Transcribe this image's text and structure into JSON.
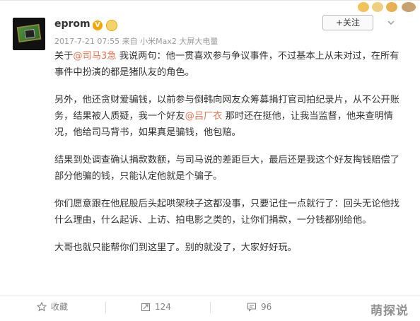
{
  "post": {
    "username": "eprom",
    "meta": "2017-7-21 07:55 来自 小米Max2 大屏大电量",
    "follow_label": "+关注"
  },
  "content": {
    "p1": [
      {
        "text": "关于",
        "mention": false
      },
      {
        "text": "@司马3急",
        "mention": true
      },
      {
        "text": " 我说两句：他一贯喜欢参与争议事件，不过基本上从未对过，在所有事件中扮演的都是猪队友的角色。",
        "mention": false
      }
    ],
    "p2": [
      {
        "text": "另外，他还贪财爱骗钱，以前参与倒韩向网友众筹募捐打官司拍纪录片，从不公开账务，结果被人质疑，我一个好友",
        "mention": false
      },
      {
        "text": "@吕厂衣",
        "mention": true
      },
      {
        "text": " 那时还在挺他，让我当监督，他来查明情况，他给司马背书，如果真是骗钱，他包赔。",
        "mention": false
      }
    ],
    "p3": "结果到处调查确认捐款数额，与司马说的差距巨大，最后还是我这个好友掏钱赔偿了部分他骗的钱，只能认定他就是个骗子。",
    "p4": "你们愿意跟在他屁股后头起哄架秧子这都没事，只要记住一点就行了：回头无论他找什么理由，什么起诉、上访、拍电影之类的，让你们捐款，一分钱都别给他。",
    "p5": "大哥也就只能帮你们到这里了。别的就没了，大家好好玩。"
  },
  "footer": {
    "favorite_label": "收藏",
    "repost_count": "124",
    "comment_count": "96"
  },
  "watermark": "萌探说",
  "colors": {
    "mention": "#eb7350",
    "meta": "#999999",
    "text": "#333333"
  }
}
